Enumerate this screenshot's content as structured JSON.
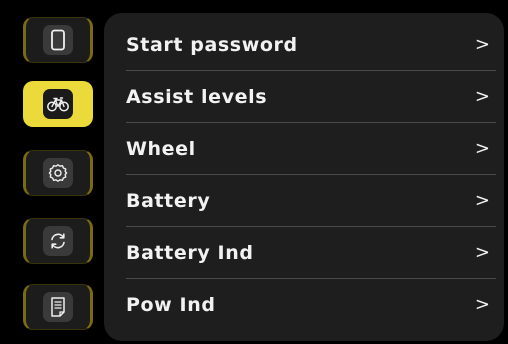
{
  "sidebar": {
    "items": [
      {
        "name": "display",
        "icon": "phone-icon",
        "active": false
      },
      {
        "name": "bike",
        "icon": "bicycle-icon",
        "active": true
      },
      {
        "name": "settings",
        "icon": "gear-icon",
        "active": false
      },
      {
        "name": "sync",
        "icon": "refresh-icon",
        "active": false
      },
      {
        "name": "info",
        "icon": "document-icon",
        "active": false
      }
    ]
  },
  "menu": {
    "items": [
      {
        "label": "Start password",
        "arrow": ">"
      },
      {
        "label": "Assist levels",
        "arrow": ">"
      },
      {
        "label": "Wheel",
        "arrow": ">"
      },
      {
        "label": "Battery",
        "arrow": ">"
      },
      {
        "label": "Battery Ind",
        "arrow": ">"
      },
      {
        "label": "Pow Ind",
        "arrow": ">"
      }
    ]
  },
  "colors": {
    "accent": "#ecd93a",
    "background": "#000000",
    "panel": "#1e1e1e",
    "text": "#f2f2f2"
  }
}
